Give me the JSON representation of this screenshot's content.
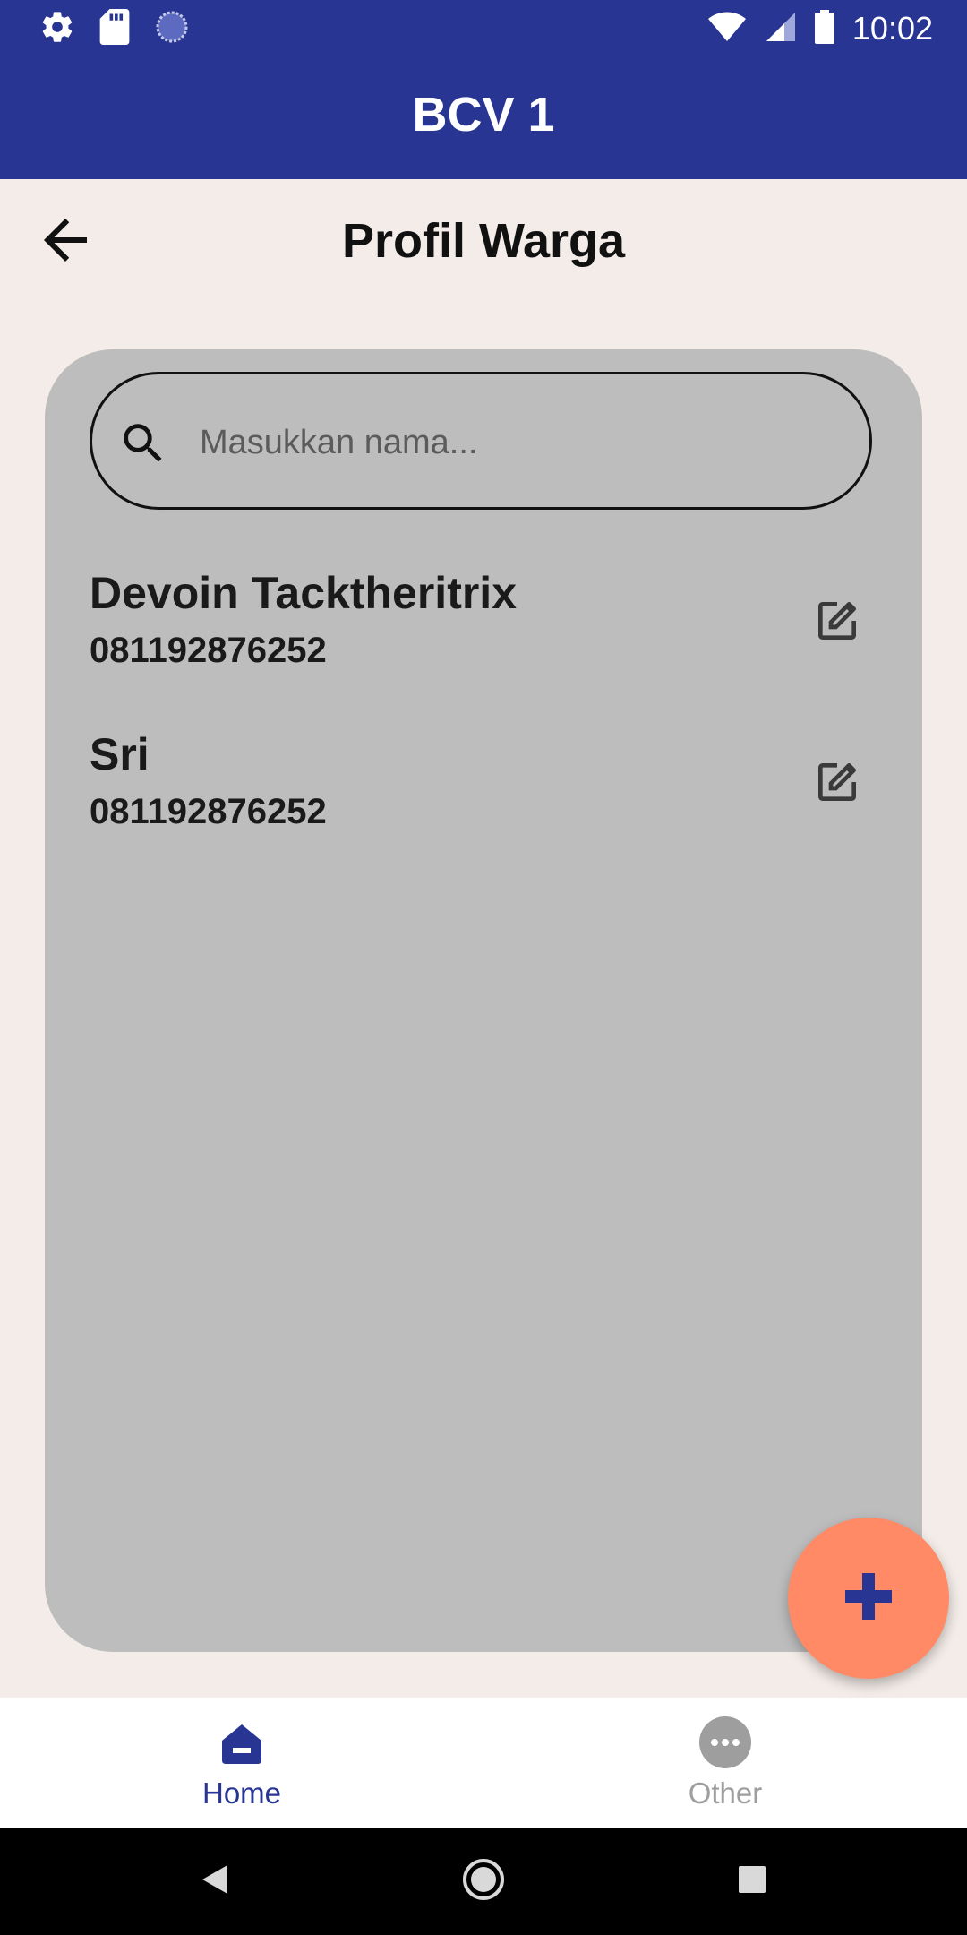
{
  "status_bar": {
    "time": "10:02",
    "left_icons": [
      "gear-icon",
      "sd-card-icon",
      "sync-circle-icon"
    ],
    "right_icons": [
      "wifi-icon",
      "signal-icon",
      "battery-icon"
    ]
  },
  "app_bar": {
    "title": "BCV 1",
    "color": "#283593"
  },
  "header": {
    "title": "Profil Warga",
    "back_icon": "arrow-back-icon"
  },
  "search": {
    "placeholder": "Masukkan nama...",
    "value": ""
  },
  "residents": [
    {
      "name": "Devoin Tacktheritrix",
      "phone": "081192876252"
    },
    {
      "name": "Sri",
      "phone": "081192876252"
    }
  ],
  "fab": {
    "icon": "plus-icon",
    "color": "#ff8a65"
  },
  "bottom_nav": {
    "items": [
      {
        "label": "Home",
        "icon": "home-icon",
        "active": true
      },
      {
        "label": "Other",
        "icon": "more-horizontal-icon",
        "active": false
      }
    ],
    "active_color": "#283593",
    "inactive_color": "#9e9e9e"
  }
}
